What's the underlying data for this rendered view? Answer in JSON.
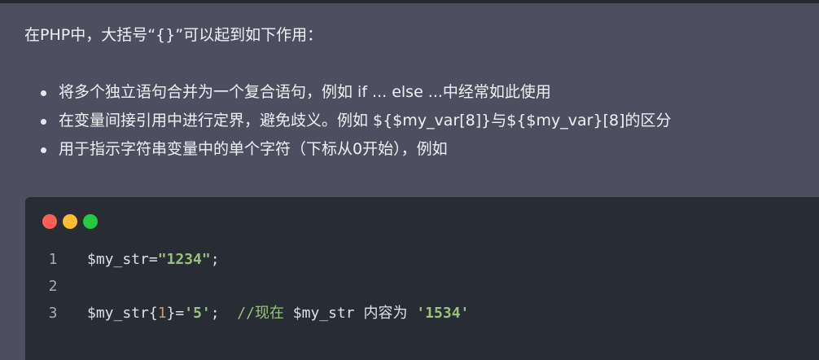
{
  "intro": "在PHP中，大括号“{}”可以起到如下作用：",
  "bullets": [
    "将多个独立语句合并为一个复合语句，例如 if ... else ...中经常如此使用",
    "在变量间接引用中进行定界，避免歧义。例如 ${$my_var[8]}与${$my_var}[8]的区分",
    "用于指示字符串变量中的单个字符（下标从0开始），例如"
  ],
  "code_window": {
    "dot_colors": [
      "#ff5f56",
      "#ffbd2e",
      "#27c93f"
    ],
    "lines": [
      {
        "number": "1",
        "tokens": [
          {
            "text": "$my_str=",
            "kind": "plain"
          },
          {
            "text": "\"1234\"",
            "kind": "str"
          },
          {
            "text": ";",
            "kind": "plain"
          }
        ]
      },
      {
        "number": "2",
        "tokens": []
      },
      {
        "number": "3",
        "tokens": [
          {
            "text": "$my_str{",
            "kind": "plain"
          },
          {
            "text": "1",
            "kind": "num"
          },
          {
            "text": "}=",
            "kind": "plain"
          },
          {
            "text": "'5'",
            "kind": "str"
          },
          {
            "text": ";  ",
            "kind": "plain"
          },
          {
            "text": "//",
            "kind": "com"
          },
          {
            "text": "现在",
            "kind": "com-cjk"
          },
          {
            "text": " $my_str ",
            "kind": "plain"
          },
          {
            "text": "内容为",
            "kind": "plain-cjk"
          },
          {
            "text": " ",
            "kind": "plain"
          },
          {
            "text": "'1534'",
            "kind": "str"
          }
        ]
      }
    ]
  }
}
